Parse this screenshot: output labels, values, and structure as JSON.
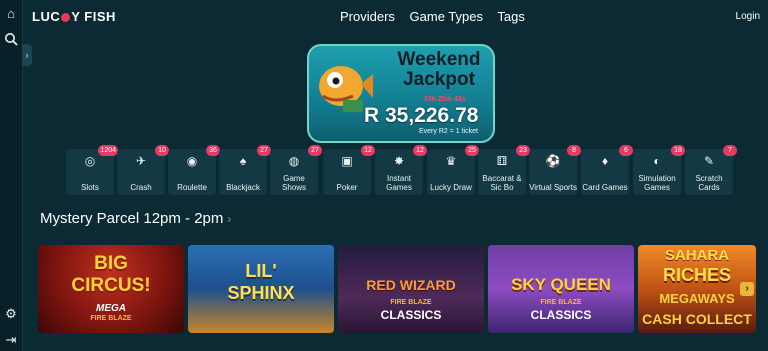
{
  "header": {
    "logo": {
      "before": "LUC",
      "after": "Y FISH"
    },
    "nav": [
      "Providers",
      "Game Types",
      "Tags"
    ],
    "login": "Login"
  },
  "rail": {
    "icons": [
      "home-icon",
      "search-icon",
      "settings-icon",
      "logout-icon"
    ],
    "collapse": "›"
  },
  "jackpot": {
    "title_line1": "Weekend",
    "title_line2": "Jackpot",
    "timer": "10h 25m 43s",
    "amount": "R 35,226.78",
    "note": "Every R2 = 1 ticket"
  },
  "categories": [
    {
      "label": "Slots",
      "count": "1204",
      "icon": "◎"
    },
    {
      "label": "Crash",
      "count": "10",
      "icon": "✈"
    },
    {
      "label": "Roulette",
      "count": "36",
      "icon": "◉"
    },
    {
      "label": "Blackjack",
      "count": "27",
      "icon": "♠"
    },
    {
      "label": "Game Shows",
      "count": "27",
      "icon": "◍"
    },
    {
      "label": "Poker",
      "count": "12",
      "icon": "▣"
    },
    {
      "label": "Instant Games",
      "count": "12",
      "icon": "✸"
    },
    {
      "label": "Lucky Draw",
      "count": "25",
      "icon": "♛"
    },
    {
      "label": "Baccarat & Sic Bo",
      "count": "23",
      "icon": "⚅"
    },
    {
      "label": "Virtual Sports",
      "count": "8",
      "icon": "⚽"
    },
    {
      "label": "Card Games",
      "count": "6",
      "icon": "♦"
    },
    {
      "label": "Simulation Games",
      "count": "18",
      "icon": "◐"
    },
    {
      "label": "Scratch Cards",
      "count": "7",
      "icon": "✎"
    }
  ],
  "section": {
    "title": "Mystery Parcel 12pm - 2pm",
    "chevron": "›"
  },
  "games": [
    {
      "line1": "BIG",
      "line2": "CIRCUS!",
      "tag": "MEGA",
      "sub": "FIRE BLAZE"
    },
    {
      "line1": "LIL'",
      "line2": "SPHINX",
      "tag": "",
      "sub": ""
    },
    {
      "line1": "RED WIZARD",
      "line2": "",
      "tag": "FIRE BLAZE",
      "sub": "CLASSICS"
    },
    {
      "line1": "SKY QUEEN",
      "line2": "",
      "tag": "FIRE BLAZE",
      "sub": "CLASSICS"
    },
    {
      "line1": "SAHARA",
      "line2": "RICHES",
      "tag": "MEGAWAYS",
      "sub": "CASH COLLECT"
    }
  ],
  "carousel_next": "›"
}
